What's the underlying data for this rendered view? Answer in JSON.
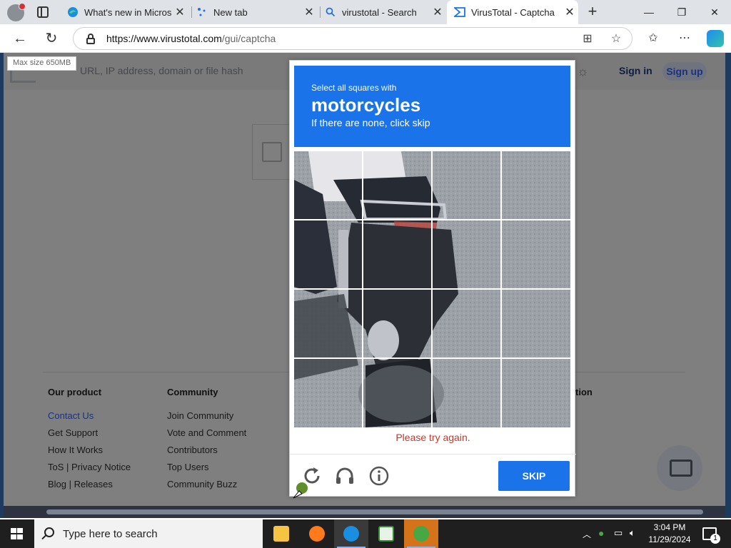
{
  "browser": {
    "tabs": [
      {
        "label": "What's new in Microsc",
        "favicon": "edge-icon"
      },
      {
        "label": "New tab",
        "favicon": "newtab-icon"
      },
      {
        "label": "virustotal - Search",
        "favicon": "search-icon"
      },
      {
        "label": "VirusTotal - Captcha",
        "favicon": "virustotal-icon",
        "active": true
      }
    ],
    "url_host": "https://www.virustotal.com",
    "url_path": "/gui/captcha"
  },
  "vt": {
    "tooltip": "Max size 650MB",
    "search_placeholder": "URL, IP address, domain or file hash",
    "sign_in": "Sign in",
    "sign_up": "Sign up"
  },
  "footer": {
    "col1": {
      "heading": "Our product",
      "links": [
        "Contact Us",
        "Get Support",
        "How It Works",
        "ToS | Privacy Notice",
        "Blog | Releases"
      ]
    },
    "col2": {
      "heading": "Community",
      "links": [
        "Join Community",
        "Vote and Comment",
        "Contributors",
        "Top Users",
        "Community Buzz"
      ]
    },
    "col3_heading_fragment": "tion"
  },
  "captcha": {
    "instruction": "Select all squares with",
    "target": "motorcycles",
    "hint": "If there are none, click skip",
    "error": "Please try again.",
    "skip_label": "SKIP",
    "tiles": 16,
    "accent": "#1a73e8",
    "error_color": "#c0392b"
  },
  "taskbar": {
    "search_placeholder": "Type here to search",
    "time": "3:04 PM",
    "date": "11/29/2024",
    "notification_count": "1"
  }
}
